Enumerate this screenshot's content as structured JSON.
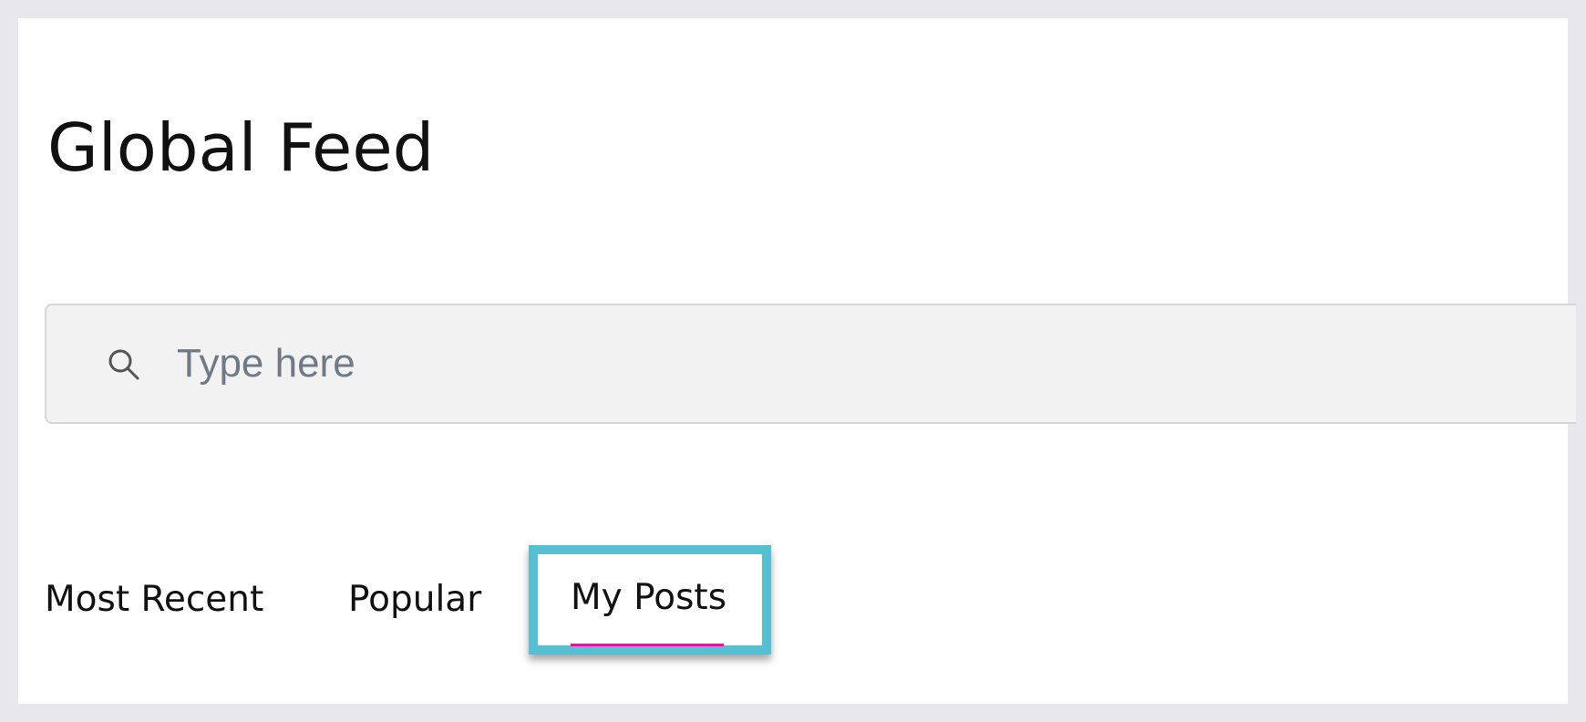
{
  "header": {
    "title": "Global Feed"
  },
  "search": {
    "placeholder": "Type here",
    "value": "",
    "icon": "search-icon"
  },
  "tabs": [
    {
      "label": "Most Recent",
      "active": false
    },
    {
      "label": "Popular",
      "active": false
    },
    {
      "label": "My Posts",
      "active": true
    }
  ],
  "colors": {
    "page_background": "#e8e7eb",
    "panel_background": "#ffffff",
    "search_background": "#f2f2f2",
    "highlight_border": "#56c0d3",
    "active_tab_underline": "#d81ba7",
    "placeholder_text": "#6e7a85"
  }
}
